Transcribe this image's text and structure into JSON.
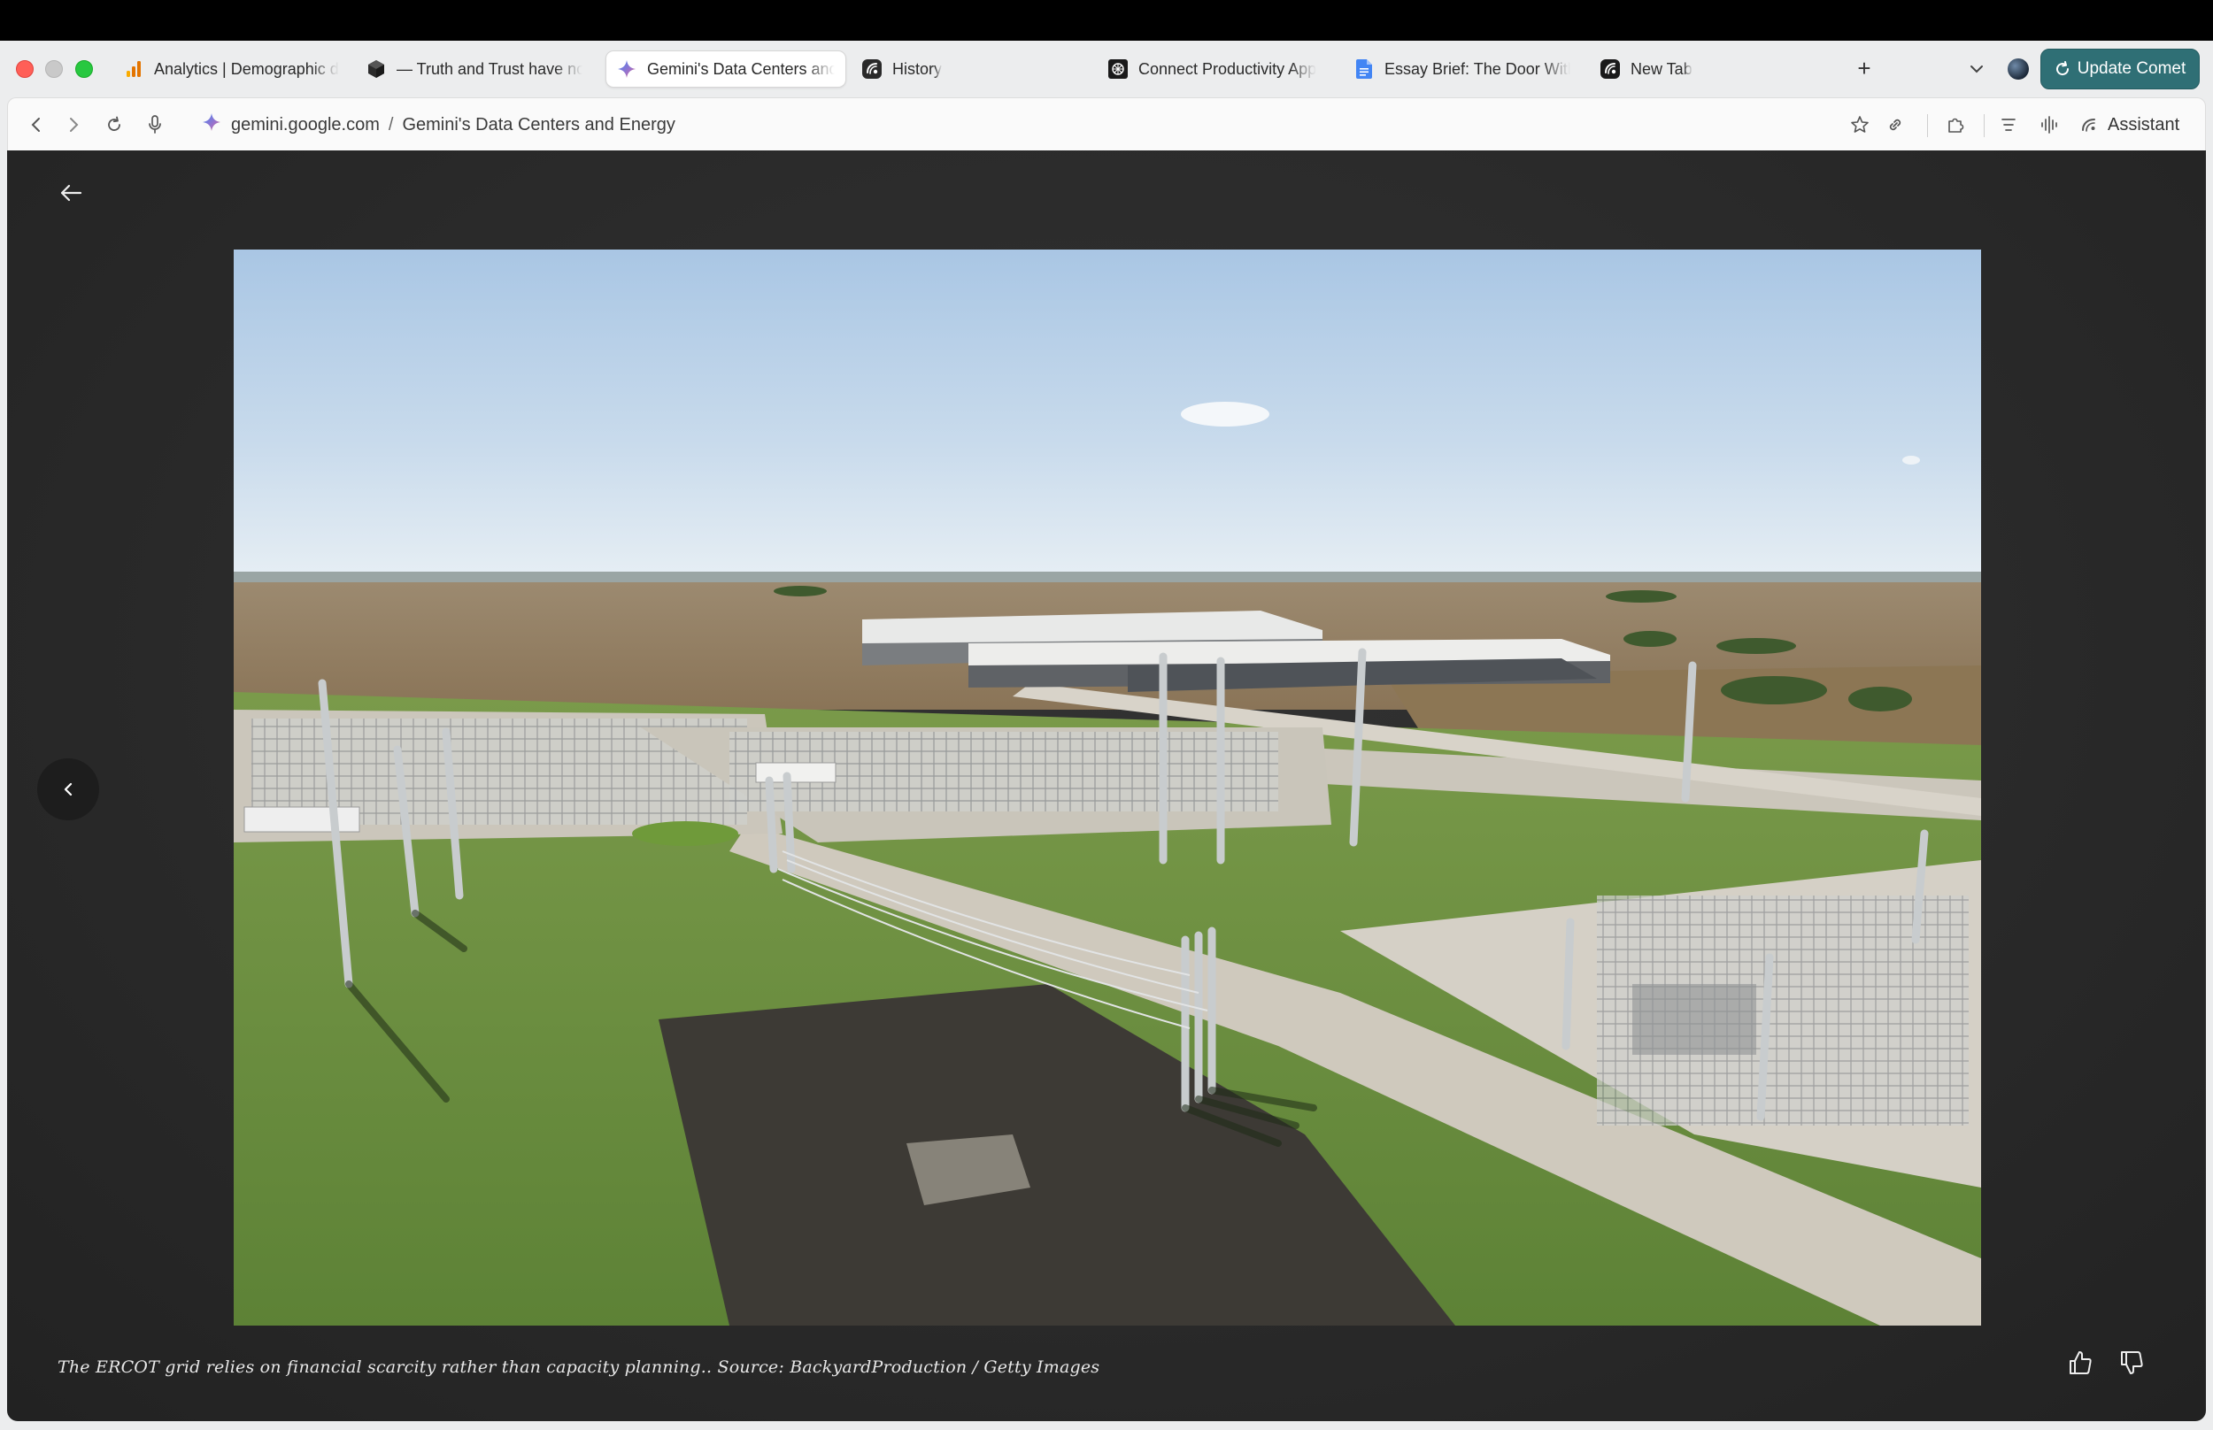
{
  "tabs": [
    {
      "label": "Analytics | Demographic d",
      "icon": "analytics-icon",
      "active": false
    },
    {
      "label": "— Truth and Trust have no",
      "icon": "cube-icon",
      "active": false
    },
    {
      "label": "Gemini's Data Centers and",
      "icon": "gemini-sparkle-icon",
      "active": true
    },
    {
      "label": "History",
      "icon": "comet-icon",
      "active": false
    },
    {
      "label": "Connect Productivity App",
      "icon": "connect-app-icon",
      "active": false
    },
    {
      "label": "Essay Brief: The Door With",
      "icon": "google-docs-icon",
      "active": false
    },
    {
      "label": "New Tab",
      "icon": "comet-icon",
      "active": false
    }
  ],
  "update_button": {
    "label": "Update Comet"
  },
  "address": {
    "domain": "gemini.google.com",
    "separator": "/",
    "page": "Gemini's Data Centers and Energy"
  },
  "assistant": {
    "label": "Assistant"
  },
  "viewer": {
    "caption": "The ERCOT grid relies on financial scarcity rather than capacity planning.. Source: BackyardProduction / Getty Images",
    "image_alt": "Aerial view of electrical substations and a large data center campus on flat farmland"
  },
  "colors": {
    "update_button": "#2f6f75",
    "viewer_bg": "#2b2b2b",
    "active_tab": "#ffffff"
  }
}
